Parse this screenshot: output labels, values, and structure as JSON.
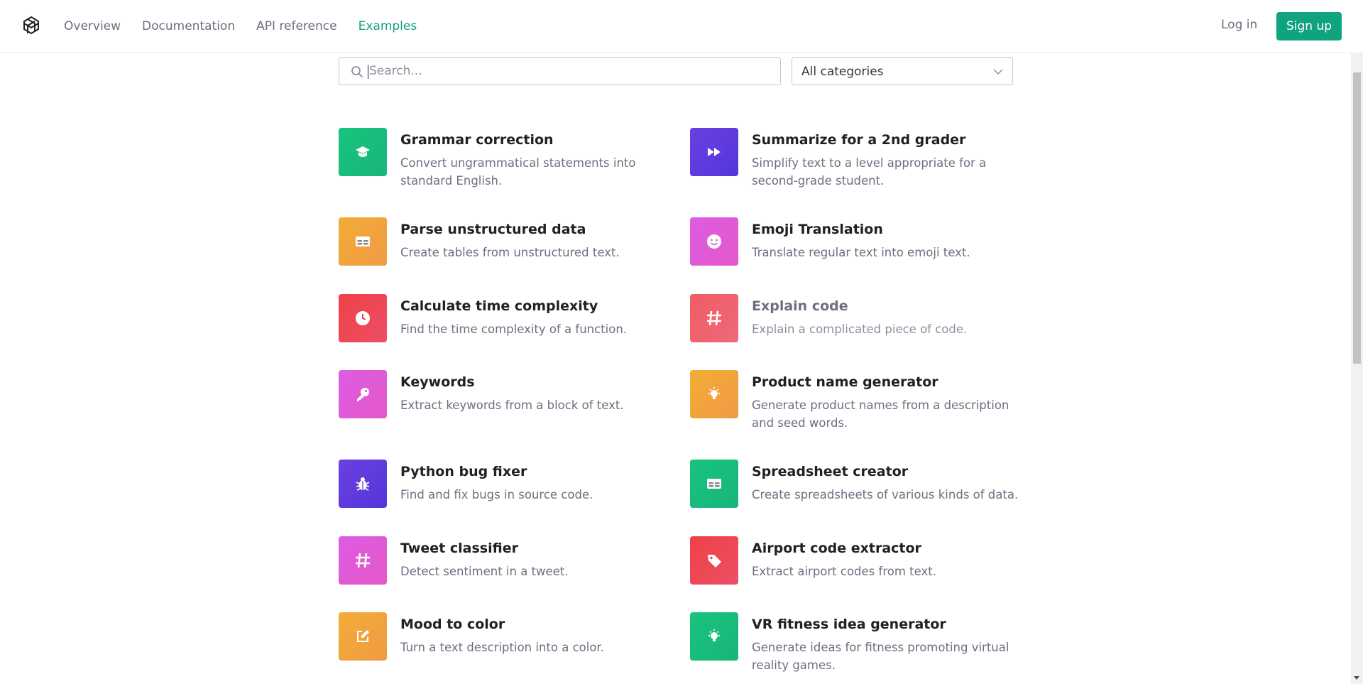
{
  "nav": {
    "links": [
      "Overview",
      "Documentation",
      "API reference",
      "Examples"
    ],
    "login": "Log in",
    "signup": "Sign up"
  },
  "filters": {
    "search_placeholder": "Search...",
    "category": "All categories"
  },
  "colors": {
    "accent": "#10a37f",
    "green": "#19c37d",
    "purple": "#5436da",
    "orange": "#f4ac36",
    "pink": "#dd5ce5",
    "red": "#ef4146"
  },
  "examples": [
    {
      "title": "Grammar correction",
      "desc": "Convert ungrammatical statements into standard English.",
      "icon": "graduation-cap-icon",
      "color": "green"
    },
    {
      "title": "Summarize for a 2nd grader",
      "desc": "Simplify text to a level appropriate for a second-grade student.",
      "icon": "fast-forward-icon",
      "color": "purple"
    },
    {
      "title": "Parse unstructured data",
      "desc": "Create tables from unstructured text.",
      "icon": "table-icon",
      "color": "orange"
    },
    {
      "title": "Emoji Translation",
      "desc": "Translate regular text into emoji text.",
      "icon": "smiley-icon",
      "color": "pink"
    },
    {
      "title": "Calculate time complexity",
      "desc": "Find the time complexity of a function.",
      "icon": "clock-icon",
      "color": "red"
    },
    {
      "title": "Explain code",
      "desc": "Explain a complicated piece of code.",
      "icon": "hashtag-icon",
      "color": "red"
    },
    {
      "title": "Keywords",
      "desc": "Extract keywords from a block of text.",
      "icon": "key-icon",
      "color": "pink"
    },
    {
      "title": "Product name generator",
      "desc": "Generate product names from a description and seed words.",
      "icon": "lightbulb-icon",
      "color": "orange"
    },
    {
      "title": "Python bug fixer",
      "desc": "Find and fix bugs in source code.",
      "icon": "bug-icon",
      "color": "purple"
    },
    {
      "title": "Spreadsheet creator",
      "desc": "Create spreadsheets of various kinds of data.",
      "icon": "table-icon",
      "color": "green"
    },
    {
      "title": "Tweet classifier",
      "desc": "Detect sentiment in a tweet.",
      "icon": "hashtag-icon",
      "color": "pink"
    },
    {
      "title": "Airport code extractor",
      "desc": "Extract airport codes from text.",
      "icon": "tag-icon",
      "color": "red"
    },
    {
      "title": "Mood to color",
      "desc": "Turn a text description into a color.",
      "icon": "edit-icon",
      "color": "orange"
    },
    {
      "title": "VR fitness idea generator",
      "desc": "Generate ideas for fitness promoting virtual reality games.",
      "icon": "lightbulb-icon",
      "color": "green"
    }
  ]
}
